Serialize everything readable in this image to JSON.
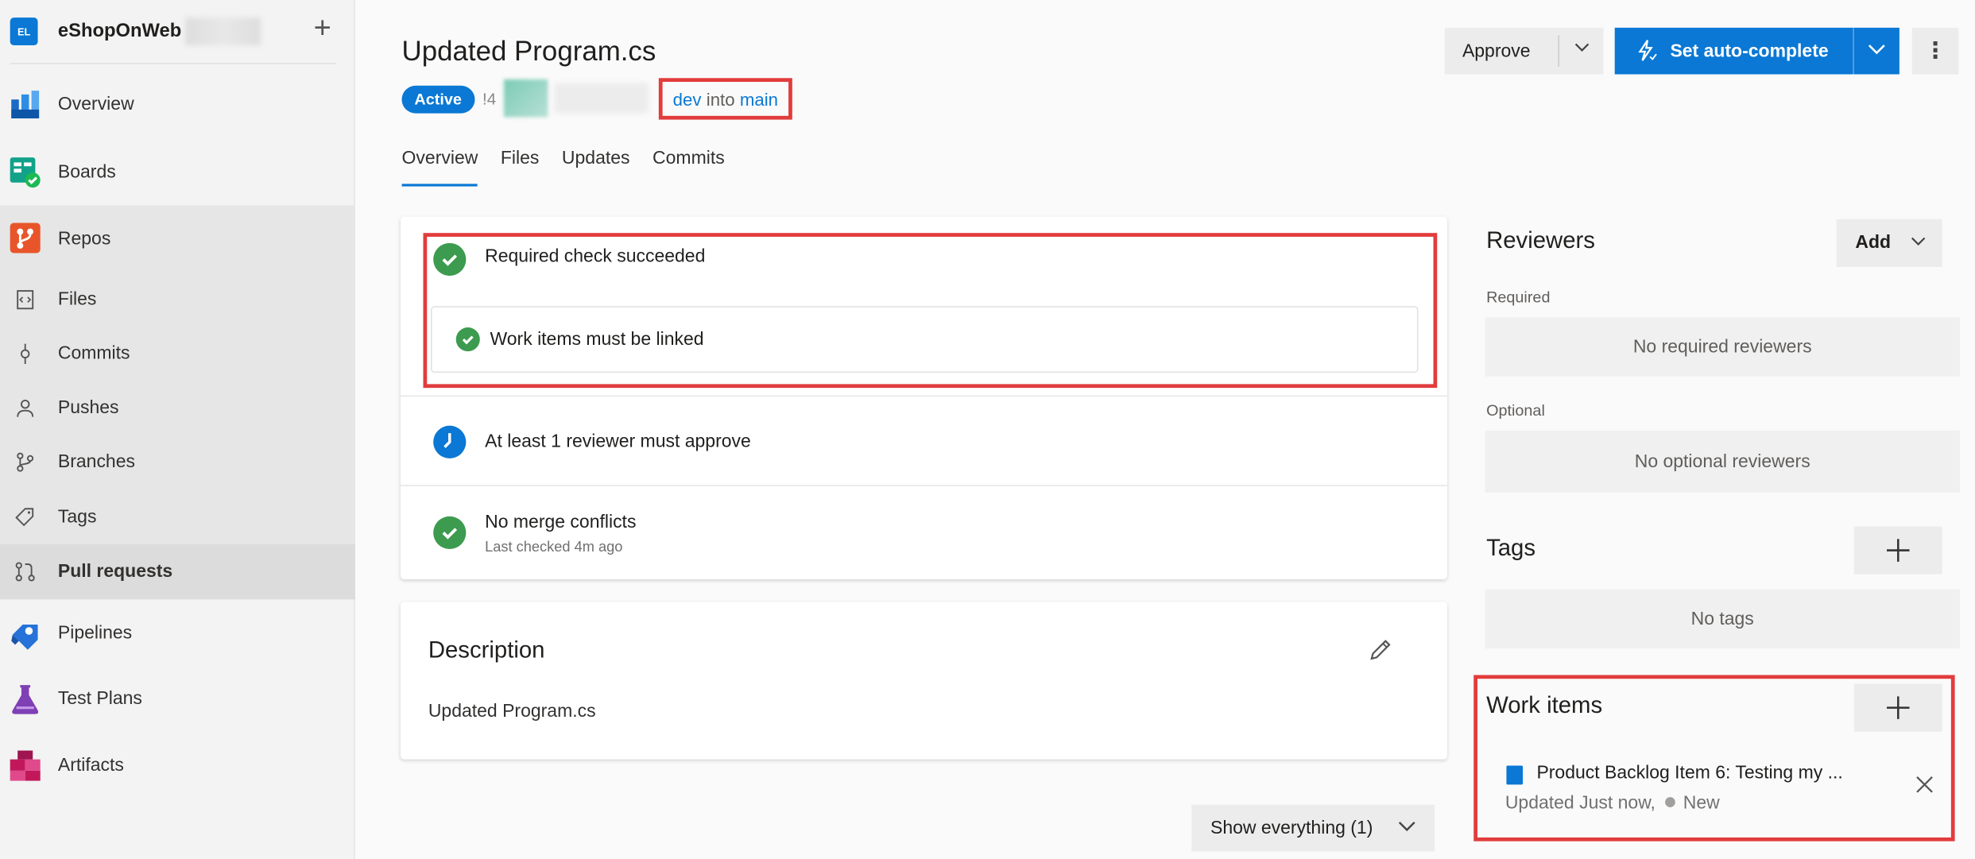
{
  "project": {
    "avatar": "EL",
    "name": "eShopOnWeb",
    "add": "+"
  },
  "nav": {
    "overview": "Overview",
    "boards": "Boards",
    "repos": "Repos",
    "files": "Files",
    "commits": "Commits",
    "pushes": "Pushes",
    "branches": "Branches",
    "tags": "Tags",
    "pull_requests": "Pull requests",
    "pipelines": "Pipelines",
    "test_plans": "Test Plans",
    "artifacts": "Artifacts"
  },
  "pr": {
    "title": "Updated Program.cs",
    "status": "Active",
    "id": "!4",
    "source_branch": "dev",
    "into": "into",
    "target_branch": "main"
  },
  "tabs": [
    "Overview",
    "Files",
    "Updates",
    "Commits"
  ],
  "toolbar": {
    "approve": "Approve",
    "auto_complete": "Set auto-complete",
    "more": "⋮"
  },
  "checks": {
    "required_check": "Required check succeeded",
    "work_items_linked": "Work items must be linked",
    "reviewer_approve": "At least 1 reviewer must approve",
    "merge_conflicts": "No merge conflicts",
    "merge_checked": "Last checked 4m ago"
  },
  "description": {
    "title": "Description",
    "body": "Updated Program.cs"
  },
  "show_everything": "Show everything (1)",
  "reviewers": {
    "title": "Reviewers",
    "add": "Add",
    "required_label": "Required",
    "required_empty": "No required reviewers",
    "optional_label": "Optional",
    "optional_empty": "No optional reviewers"
  },
  "tags": {
    "title": "Tags",
    "empty": "No tags"
  },
  "work_items": {
    "title": "Work items",
    "item_title": "Product Backlog Item 6: Testing my ...",
    "item_updated": "Updated Just now,",
    "item_state": "New"
  },
  "colors": {
    "accent": "#0a78d4",
    "success": "#3c9b4f",
    "highlight": "#e23c3c"
  }
}
